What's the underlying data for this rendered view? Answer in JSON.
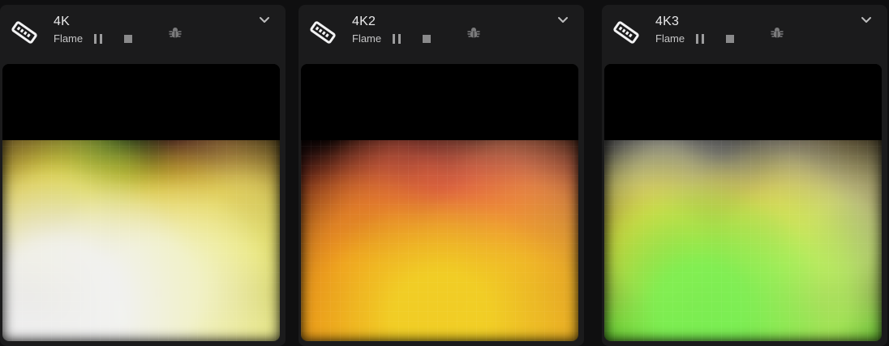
{
  "devices": [
    {
      "name": "4K",
      "effect": "Flame",
      "icons": {
        "device": "led-strip-icon",
        "pause": "pause-icon",
        "stop": "stop-icon",
        "bug": "bug-icon",
        "collapse": "chevron-down-icon"
      }
    },
    {
      "name": "4K2",
      "effect": "Flame",
      "icons": {
        "device": "led-strip-icon",
        "pause": "pause-icon",
        "stop": "stop-icon",
        "bug": "bug-icon",
        "collapse": "chevron-down-icon"
      }
    },
    {
      "name": "4K3",
      "effect": "Flame",
      "icons": {
        "device": "led-strip-icon",
        "pause": "pause-icon",
        "stop": "stop-icon",
        "bug": "bug-icon",
        "collapse": "chevron-down-icon"
      }
    }
  ],
  "theme": {
    "background": "#0f0f10",
    "card": "#1b1b1c",
    "text_primary": "#e9e9ea",
    "text_secondary": "#c6c6c7",
    "icon_gray": "#8a8a8b"
  }
}
